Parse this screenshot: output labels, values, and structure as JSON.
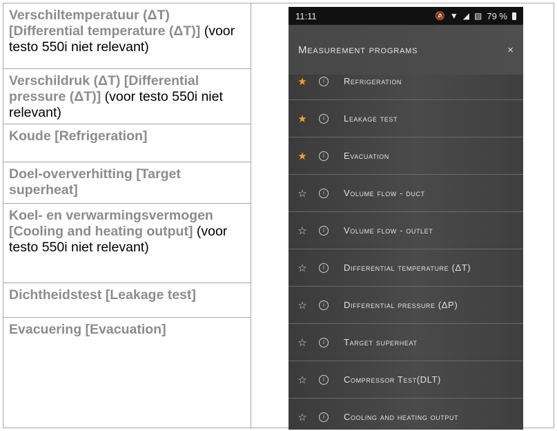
{
  "doc": {
    "rows": [
      {
        "bold": "Verschiltemperatuur (ΔT) [Differential temperature (ΔT)]",
        "plain": "(voor testo 550i niet relevant)"
      },
      {
        "bold": "Verschildruk (ΔT) [Differential pressure (ΔT)]",
        "plain": "(voor testo 550i niet relevant)"
      },
      {
        "bold": "Koude [Refrigeration]",
        "plain": ""
      },
      {
        "bold": "Doel-oververhitting [Target superheat]",
        "plain": ""
      },
      {
        "bold": "Koel- en verwarmingsvermogen [Cooling and heating output]",
        "plain": "(voor testo 550i niet relevant)"
      },
      {
        "bold": "Dichtheidstest [Leakage test]",
        "plain": ""
      },
      {
        "bold": "Evacuering [Evacuation]",
        "plain": ""
      }
    ]
  },
  "phone": {
    "status": {
      "time": "11:11",
      "battery": "79 %"
    },
    "header_title": "Measurement programs",
    "close_label": "×",
    "items": [
      {
        "label": "Refrigeration",
        "favorite": true
      },
      {
        "label": "Leakage test",
        "favorite": true
      },
      {
        "label": "Evacuation",
        "favorite": true
      },
      {
        "label": "Volume flow - duct",
        "favorite": false
      },
      {
        "label": "Volume flow - outlet",
        "favorite": false
      },
      {
        "label": "Differential temperature (ΔT)",
        "favorite": false
      },
      {
        "label": "Differential pressure (ΔP)",
        "favorite": false
      },
      {
        "label": "Target superheat",
        "favorite": false
      },
      {
        "label": "Compressor Test(DLT)",
        "favorite": false
      },
      {
        "label": "Cooling and heating output",
        "favorite": false
      }
    ],
    "colors": {
      "favorite_star": "#f0a322",
      "background": "#444444"
    }
  }
}
